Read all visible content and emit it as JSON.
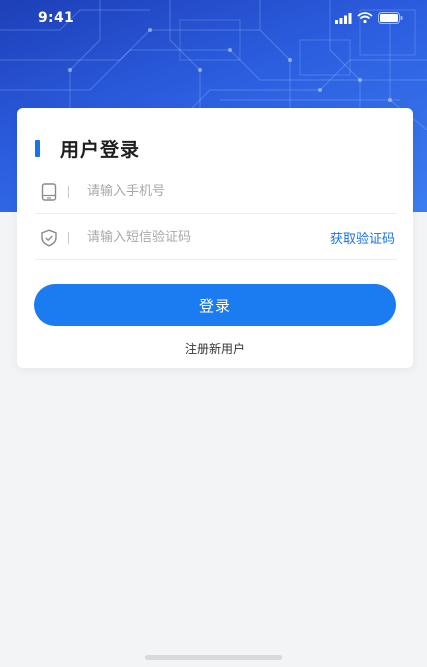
{
  "status_bar": {
    "time": "9:41",
    "icons": [
      "cellular-signal-icon",
      "wifi-icon",
      "battery-icon"
    ]
  },
  "login_card": {
    "title": "用户登录",
    "phone_field": {
      "placeholder": "请输入手机号",
      "value": "",
      "icon": "phone-icon"
    },
    "code_field": {
      "placeholder": "请输入短信验证码",
      "value": "",
      "icon": "shield-check-icon"
    },
    "get_code_label": "获取验证码",
    "login_button_label": "登录",
    "register_link_label": "注册新用户"
  },
  "colors": {
    "accent": "#1a73e8",
    "button": "#1a7cf0",
    "hero_top": "#1d3fb8",
    "hero_bottom": "#3c7df0",
    "background": "#f3f4f6"
  }
}
